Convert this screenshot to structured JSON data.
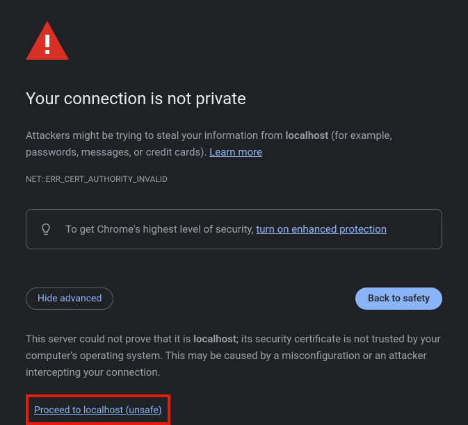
{
  "heading": "Your connection is not private",
  "description_prefix": "Attackers might be trying to steal your information from ",
  "hostname": "localhost",
  "description_suffix": " (for example, passwords, messages, or credit cards). ",
  "learn_more": "Learn more",
  "error_code": "NET::ERR_CERT_AUTHORITY_INVALID",
  "security_banner": {
    "text_prefix": "To get Chrome's highest level of security, ",
    "link": "turn on enhanced protection"
  },
  "buttons": {
    "hide_advanced": "Hide advanced",
    "back_to_safety": "Back to safety"
  },
  "advanced": {
    "text_prefix": "This server could not prove that it is ",
    "hostname": "localhost",
    "text_suffix": "; its security certificate is not trusted by your computer's operating system. This may be caused by a misconfiguration or an attacker intercepting your connection."
  },
  "proceed_link": "Proceed to localhost (unsafe)"
}
